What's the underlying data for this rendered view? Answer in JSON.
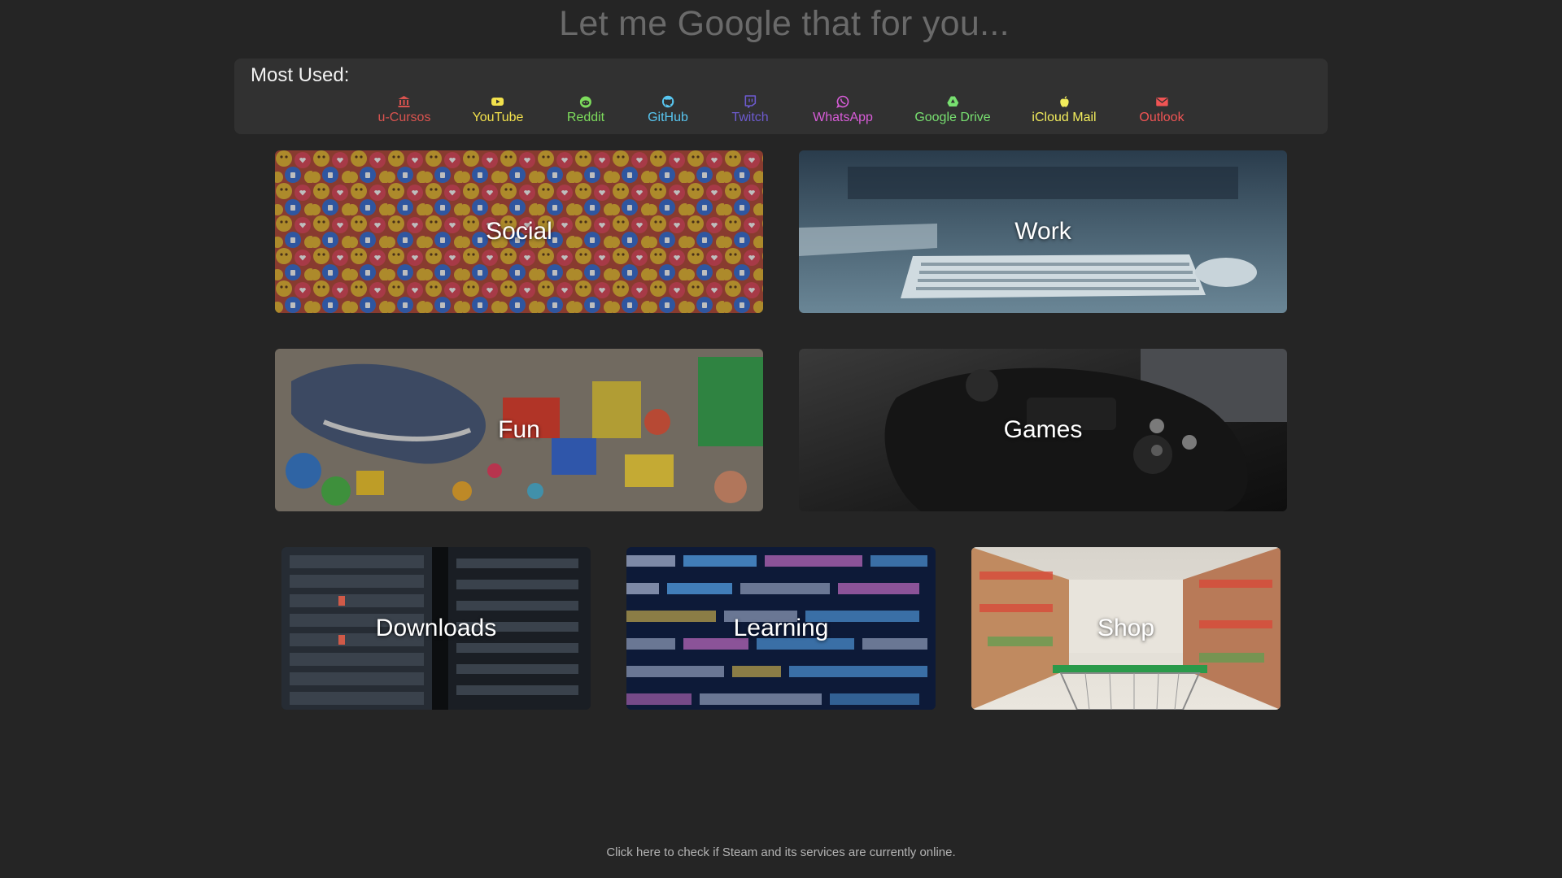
{
  "search": {
    "placeholder": "Let me Google that for you..."
  },
  "most_used": {
    "title": "Most Used:",
    "items": [
      {
        "label": "u-Cursos",
        "icon": "university-icon",
        "color": "#d9534f"
      },
      {
        "label": "YouTube",
        "icon": "youtube-icon",
        "color": "#f2e14c"
      },
      {
        "label": "Reddit",
        "icon": "reddit-icon",
        "color": "#7ddc5c"
      },
      {
        "label": "GitHub",
        "icon": "github-icon",
        "color": "#58c6f0"
      },
      {
        "label": "Twitch",
        "icon": "twitch-icon",
        "color": "#6d5bd0"
      },
      {
        "label": "WhatsApp",
        "icon": "whatsapp-icon",
        "color": "#d85cd8"
      },
      {
        "label": "Google Drive",
        "icon": "google-drive-icon",
        "color": "#78e070"
      },
      {
        "label": "iCloud Mail",
        "icon": "apple-icon",
        "color": "#f2ec5c"
      },
      {
        "label": "Outlook",
        "icon": "envelope-icon",
        "color": "#f05454"
      }
    ]
  },
  "categories": [
    {
      "label": "Social",
      "image": "reaction-emoji-collage"
    },
    {
      "label": "Work",
      "image": "desk-keyboard-mouse"
    },
    {
      "label": "Fun",
      "image": "toys-and-plush-shark"
    },
    {
      "label": "Games",
      "image": "game-controller"
    },
    {
      "label": "Downloads",
      "image": "server-rack"
    },
    {
      "label": "Learning",
      "image": "source-code"
    },
    {
      "label": "Shop",
      "image": "supermarket-cart"
    }
  ],
  "footer": {
    "status_link": "Click here to check if Steam and its services are currently online."
  }
}
